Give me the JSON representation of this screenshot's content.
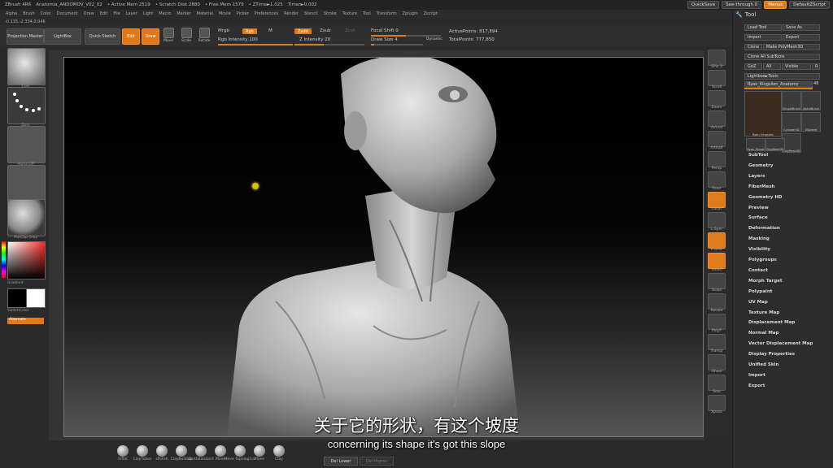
{
  "titlebar": {
    "app": "ZBrush 4R6",
    "doc": "Anatomia_ANDOMOV_V02_02",
    "active_mem": "• Active Mem 2519",
    "scratch": "• Scratch Disk 2880",
    "free_mem": "• Free Mem 1579",
    "ztime": "• ZTime►1.025",
    "timer": "Timer►0.002",
    "quicksave": "QuickSave",
    "seethrough": "See-through  0",
    "menus": "Menus",
    "script": "DefaultZScript"
  },
  "menubar": [
    "Alpha",
    "Brush",
    "Color",
    "Document",
    "Draw",
    "Edit",
    "File",
    "Layer",
    "Light",
    "Macro",
    "Marker",
    "Material",
    "Movie",
    "Picker",
    "Preferences",
    "Render",
    "Stencil",
    "Stroke",
    "Texture",
    "Tool",
    "Transform",
    "Zplugin",
    "Zscript"
  ],
  "coords": "-0.135,-2.334,0.046",
  "toolbar": {
    "projection_master": "Projection Master",
    "lightbox": "LightBox",
    "quick_sketch": "Quick Sketch",
    "edit": "Edit",
    "draw": "Draw",
    "move": "Move",
    "scale": "Scale",
    "rotate": "Rotate",
    "mrgb": "Mrgb",
    "rgb": "Rgb",
    "m": "M",
    "rgb_intensity": "Rgb Intensity 100",
    "zadd": "Zadd",
    "zsub": "Zsub",
    "zcut": "Zcut",
    "z_intensity": "Z Intensity 20",
    "focal_shift": "Focal Shift 0",
    "draw_size": "Draw Size 4",
    "dynamic": "Dynamic",
    "active_points": "ActivePoints: 817,894",
    "total_points": "TotalPoints: 777,850"
  },
  "leftpanel": {
    "brush_label": "Clay",
    "stroke_label": "Dots",
    "alpha_label": "Alpha Off",
    "texture_label": "Texture Off",
    "material_label": "MatCap Gray",
    "gradient_label": "Gradient",
    "switchcolor_label": "SwitchColor",
    "alternate_label": "Alternate"
  },
  "rightshelf": [
    "SPix 3",
    "Scroll",
    "Zoom",
    "Actual",
    "AAHalf",
    "Persp",
    "Floor",
    "Local",
    "L.Sym",
    "Frame",
    "Move",
    "Scale",
    "Rotate",
    "PolyF",
    "Transp",
    "Ghost",
    "Solo",
    "Xpose"
  ],
  "toolpanel": {
    "title": "Tool",
    "load_tool": "Load Tool",
    "save_as": "Save As",
    "import": "Import",
    "export": "Export",
    "clone": "Clone",
    "make_polymesh": "Make PolyMesh3D",
    "clone_all": "Clone All SubTools",
    "goz": "GoZ",
    "all": "All",
    "visible": "Visible",
    "r": "R",
    "lightbox_tools": "Lightbox►Tools",
    "current_tool": "Ryan_Kingslien_Anatomy",
    "current_count": "48",
    "thumbs": [
      "Ryan_Kingslien",
      "SimpleBrush",
      "AlphaBrush",
      "Cylinder3D",
      "ZSphere",
      "PolyMesh3D",
      "Ryan_Kingsl",
      "PolyMesh3D"
    ],
    "menu": [
      "SubTool",
      "Geometry",
      "Layers",
      "FiberMesh",
      "Geometry HD",
      "Preview",
      "Surface",
      "Deformation",
      "Masking",
      "Visibility",
      "Polygroups",
      "Contact",
      "Morph Target",
      "Polypaint",
      "UV Map",
      "Texture Map",
      "Displacement Map",
      "Normal Map",
      "Vector Displacement Map",
      "Display Properties",
      "Unified Skin",
      "Import",
      "Export"
    ]
  },
  "bottombar": {
    "brushes": [
      "Inflat",
      "ClayTubes",
      "sPolish",
      "ClayBuildup",
      "DamStandard",
      "Move",
      "Move Topological",
      "Move",
      "Clay"
    ],
    "del_lower": "Del Lower",
    "del_higher": "Del Higher"
  },
  "subtitle": {
    "cn": "关于它的形状，有这个坡度",
    "en": "concerning its shape it's got this slope"
  },
  "colors": {
    "accent": "#e07a1a",
    "panel": "#2d2d2d",
    "canvas_top": "#000000"
  }
}
